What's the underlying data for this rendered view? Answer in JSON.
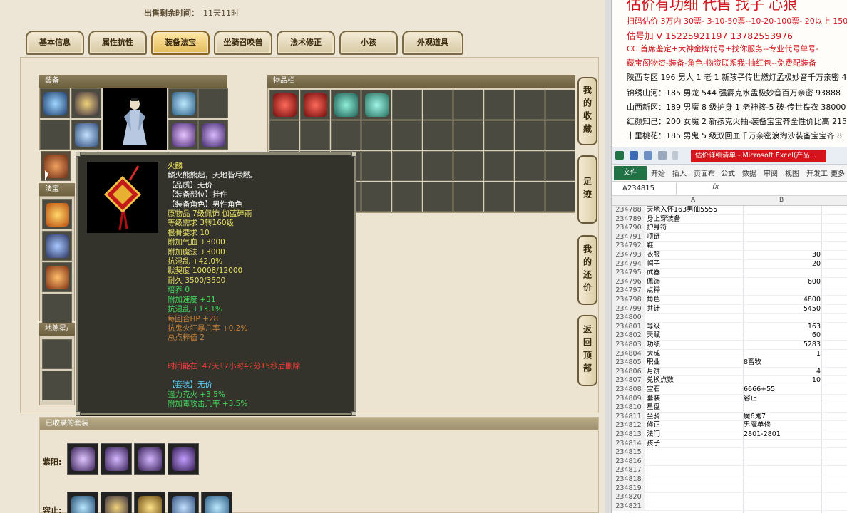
{
  "sale": {
    "label": "出售剩余时间：",
    "value": "11天11时"
  },
  "tabs": [
    {
      "label": "基本信息"
    },
    {
      "label": "属性抗性"
    },
    {
      "label": "装备法宝"
    },
    {
      "label": "坐骑召唤兽"
    },
    {
      "label": "法术修正"
    },
    {
      "label": "小孩"
    },
    {
      "label": "外观道具"
    }
  ],
  "sections": {
    "equip": "装备",
    "inventory": "物品栏",
    "fabao": "法宝",
    "dizhen": "地煞星/",
    "suits": "已收录的套装"
  },
  "side_buttons": [
    {
      "label": "我的收藏"
    },
    {
      "label": "足迹"
    },
    {
      "label": "我的还价"
    },
    {
      "label": "返回顶部"
    }
  ],
  "tooltip": {
    "lines": [
      {
        "text": "火麟",
        "color": "#f2e25a"
      },
      {
        "text": "麟火熊熊起，天地皆尽燃。",
        "color": "#ffffff"
      },
      {
        "text": "【品质】无价",
        "color": "#ffffff"
      },
      {
        "text": "【装备部位】挂件",
        "color": "#ffffff"
      },
      {
        "text": "【装备角色】男性角色",
        "color": "#ffffff"
      },
      {
        "text": "原物品 7级佩饰 伽蓝碎雨",
        "color": "#e8e065"
      },
      {
        "text": "等级需求 3转160级",
        "color": "#e8e065"
      },
      {
        "text": "根骨要求 10",
        "color": "#e8e065"
      },
      {
        "text": "附加气血 +3000",
        "color": "#e8e065"
      },
      {
        "text": "附加魔法 +3000",
        "color": "#e8e065"
      },
      {
        "text": "抗混乱 +42.0%",
        "color": "#e8e065"
      },
      {
        "text": "默契度 10008/12000",
        "color": "#e8e065"
      },
      {
        "text": "耐久 3500/3500",
        "color": "#e8e065"
      },
      {
        "text": "培养 0",
        "color": "#42d85c"
      },
      {
        "text": "附加速度 +31",
        "color": "#42d85c"
      },
      {
        "text": "抗混乱 +13.1%",
        "color": "#42d85c"
      },
      {
        "text": "每回合HP +28",
        "color": "#c7823a"
      },
      {
        "text": "抗鬼火狂暴几率 +0.2%",
        "color": "#c7823a"
      },
      {
        "text": "总点粹值 2",
        "color": "#c7823a"
      },
      {
        "text": "",
        "color": "#ffffff"
      },
      {
        "text": "",
        "color": "#ffffff"
      },
      {
        "text": "时间能在147天17小时42分15秒后删除",
        "color": "#ff3b3b"
      },
      {
        "text": "",
        "color": "#ffffff"
      },
      {
        "text": "【套装】无价",
        "color": "#5ad6ff"
      },
      {
        "text": "强力克火 +3.5%",
        "color": "#42d85c"
      },
      {
        "text": "附加毒攻击几率 +3.5%",
        "color": "#42d85c"
      }
    ]
  },
  "suits": {
    "rows": [
      {
        "label": "紫阳:"
      },
      {
        "label": "容止:"
      }
    ]
  },
  "ads": {
    "headline": "估价有功细 代售 找子 心狼",
    "lines": [
      {
        "text": "扫码估价 3万内 30票- 3-10-50票--10-20-100票- 20以上 150-",
        "color": "#d4141b"
      },
      {
        "text": "估号加 V 15225921197 13782553976",
        "color": "#d4141b"
      },
      {
        "text": "CC 首席鉴定+大神金牌代号+找你服务--专业代号单号-",
        "color": "#d4141b"
      },
      {
        "text": "藏宝阁物资-装备-角色-物资联系我-抽红包--免费配装备",
        "color": "#d4141b"
      },
      {
        "text": "陕西专区 196 男人 1 老 1 新孩子传世燃灯孟极妙音千万亲密 4",
        "color": "#111111"
      },
      {
        "text": "锦绣山河：185 男龙 544 强霹克水孟极妙音百万亲密 93888",
        "color": "#111111"
      },
      {
        "text": "山西新区：189 男魔 8 级护身 1 老神孩-5 破-传世铁衣 38000",
        "color": "#111111"
      },
      {
        "text": "红颜知己：200 女魔 2 新孩克火抽-装备宝宝齐全性价比高 215",
        "color": "#111111"
      },
      {
        "text": "十里桃花：185 男鬼 5 级双回血千万亲密浪淘沙装备宝宝齐 8",
        "color": "#111111"
      }
    ]
  },
  "excel": {
    "doc_title": "估价详细清单 - Microsoft Excel(产品...",
    "ribbon_tabs": [
      "文件",
      "开始",
      "插入",
      "页面布",
      "公式",
      "数据",
      "审阅",
      "视图",
      "开发工",
      "更多"
    ],
    "name_box": "A234815",
    "fx": "fx",
    "columns": [
      "A",
      "B"
    ],
    "rows": [
      {
        "n": "234788",
        "a": "天地入怀163男仙5555",
        "b": ""
      },
      {
        "n": "234789",
        "a": "身上穿装备",
        "b": ""
      },
      {
        "n": "234790",
        "a": "护身符",
        "b": ""
      },
      {
        "n": "234791",
        "a": "项链",
        "b": ""
      },
      {
        "n": "234792",
        "a": "鞋",
        "b": ""
      },
      {
        "n": "234793",
        "a": "衣服",
        "b": "30"
      },
      {
        "n": "234794",
        "a": "帽子",
        "b": "20"
      },
      {
        "n": "234795",
        "a": "武器",
        "b": ""
      },
      {
        "n": "234796",
        "a": "佩饰",
        "b": "600"
      },
      {
        "n": "234797",
        "a": "点粹",
        "b": ""
      },
      {
        "n": "234798",
        "a": "角色",
        "b": "4800"
      },
      {
        "n": "234799",
        "a": "共计",
        "b": "5450"
      },
      {
        "n": "234800",
        "a": "",
        "b": ""
      },
      {
        "n": "234801",
        "a": "等级",
        "b": "163"
      },
      {
        "n": "234802",
        "a": "天赋",
        "b": "60"
      },
      {
        "n": "234803",
        "a": "功绩",
        "b": "5283"
      },
      {
        "n": "234804",
        "a": "大成",
        "b": "1"
      },
      {
        "n": "234805",
        "a": "职业",
        "b": "8畜牧"
      },
      {
        "n": "234806",
        "a": "月饼",
        "b": "4"
      },
      {
        "n": "234807",
        "a": "兑换点数",
        "b": "10"
      },
      {
        "n": "234808",
        "a": "宝石",
        "b": "6666+55"
      },
      {
        "n": "234809",
        "a": "套装",
        "b": "容止"
      },
      {
        "n": "234810",
        "a": "星盘",
        "b": ""
      },
      {
        "n": "234811",
        "a": "坐骑",
        "b": "魔6鬼7"
      },
      {
        "n": "234812",
        "a": "修正",
        "b": "男魔单修"
      },
      {
        "n": "234813",
        "a": "法门",
        "b": "2801-2801"
      },
      {
        "n": "234814",
        "a": "孩子",
        "b": ""
      },
      {
        "n": "234815",
        "a": "",
        "b": ""
      },
      {
        "n": "234816",
        "a": "",
        "b": ""
      },
      {
        "n": "234817",
        "a": "",
        "b": ""
      },
      {
        "n": "234818",
        "a": "",
        "b": ""
      },
      {
        "n": "234819",
        "a": "",
        "b": ""
      },
      {
        "n": "234820",
        "a": "",
        "b": ""
      },
      {
        "n": "234821",
        "a": "",
        "b": ""
      }
    ]
  },
  "colors": {
    "tab_active": "#e2b958",
    "excel_green": "#217346",
    "title_red": "#d6141b",
    "tooltip_bg": "#33332c"
  }
}
